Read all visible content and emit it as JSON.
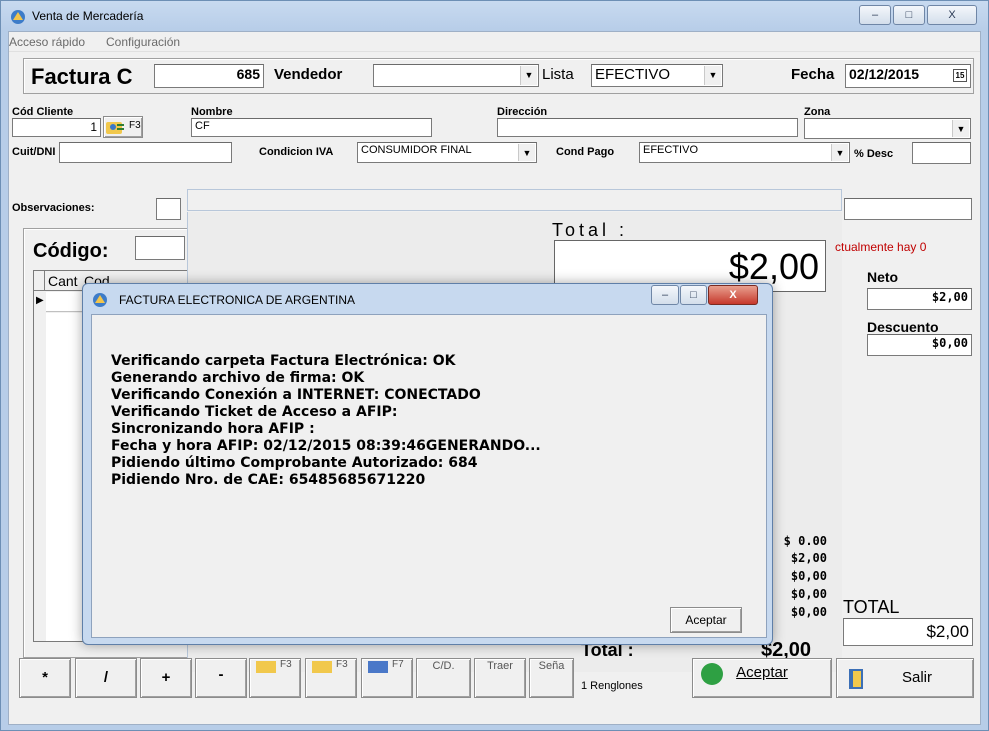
{
  "window": {
    "title": "Venta de Mercadería",
    "controls": {
      "minimize": "–",
      "maximize": "□",
      "close": "X"
    }
  },
  "menu": [
    "Acceso rápido",
    "Configuración"
  ],
  "header": {
    "doc_type": "Factura C",
    "number": "685",
    "vendedor_label": "Vendedor",
    "vendedor_value": "",
    "lista_label": "Lista",
    "lista_value": "EFECTIVO",
    "fecha_label": "Fecha",
    "fecha_value": "02/12/2015",
    "calendar_glyph": "15"
  },
  "client": {
    "cod_label": "Cód Cliente",
    "cod_value": "1",
    "f3": "F3",
    "nombre_label": "Nombre",
    "nombre_value": "CF",
    "direccion_label": "Dirección",
    "direccion_value": "",
    "zona_label": "Zona",
    "zona_value": "",
    "cuit_label": "Cuit/DNI",
    "cuit_value": "",
    "cond_iva_label": "Condicion IVA",
    "cond_iva_value": "CONSUMIDOR FINAL",
    "cond_pago_label": "Cond Pago",
    "cond_pago_value": "EFECTIVO",
    "desc_label": "% Desc",
    "desc_value": "",
    "obs_label": "Observaciones:",
    "obs_value": ""
  },
  "items": {
    "codigo_label": "Código:",
    "col_cant": "Cant",
    "col_cod": "Cod"
  },
  "total_panel": {
    "label": "Total :",
    "value": "$2,00"
  },
  "right_panel": {
    "notice": "ctualmente hay 0",
    "neto_label": "Neto",
    "neto_value": "$2,00",
    "descuento_label": "Descuento",
    "descuento_value": "$0,00",
    "total_label": "TOTAL",
    "total_value": "$2,00"
  },
  "summary_values": [
    "$ 0.00",
    "$2,00",
    "$0,00",
    "$0,00",
    "$0,00"
  ],
  "bottom_total": {
    "label": "Total :",
    "value": "$2,00"
  },
  "toolbar": {
    "star": "*",
    "slash": "/",
    "plus": "+",
    "minus": "-",
    "f3a": "F3",
    "f3b": "F3",
    "f7": "F7",
    "cd": "C/D.",
    "traer": "Traer",
    "sena": "Seña",
    "renglones": "1 Renglones",
    "aceptar": "Aceptar",
    "salir": "Salir"
  },
  "dialog": {
    "title": "FACTURA ELECTRONICA DE ARGENTINA",
    "lines": [
      "Verificando carpeta Factura Electrónica: OK",
      "Generando archivo de firma: OK",
      "Verificando Conexión a INTERNET: CONECTADO",
      "Verificando Ticket de Acceso a AFIP:",
      "Sincronizando hora AFIP :",
      "Fecha y hora AFIP: 02/12/2015 08:39:46GENERANDO...",
      "Pidiendo último Comprobante Autorizado: 684",
      "Pidiendo Nro. de CAE: 65485685671220"
    ],
    "ok_button": "Aceptar",
    "controls": {
      "minimize": "–",
      "maximize": "□",
      "close": "X"
    }
  },
  "colors": {
    "notice_red": "#c00000",
    "close_red": "#c6382c",
    "accept_green": "#2ea043"
  }
}
